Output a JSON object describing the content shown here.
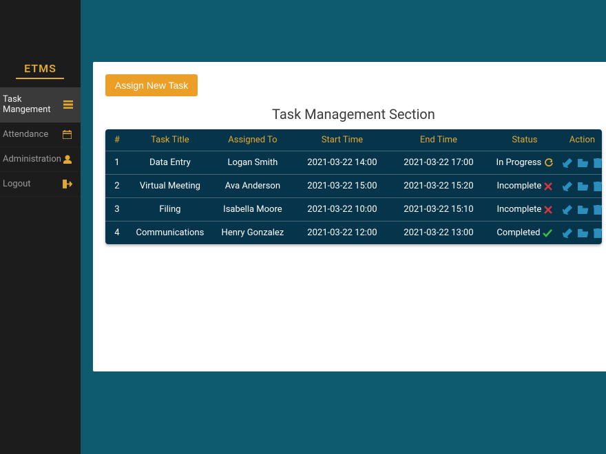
{
  "brand": "ETMS",
  "sidebar": {
    "items": [
      {
        "label": "Task Mangement",
        "icon": "list-icon",
        "active": true
      },
      {
        "label": "Attendance",
        "icon": "calendar-icon",
        "active": false
      },
      {
        "label": "Administration",
        "icon": "user-icon",
        "active": false
      },
      {
        "label": "Logout",
        "icon": "logout-icon",
        "active": false
      }
    ]
  },
  "main": {
    "assign_button": "Assign New Task",
    "section_title": "Task Management Section",
    "columns": {
      "idx": "#",
      "title": "Task Title",
      "assigned": "Assigned To",
      "start": "Start Time",
      "end": "End Time",
      "status": "Status",
      "action": "Action"
    },
    "rows": [
      {
        "idx": "1",
        "title": "Data Entry",
        "assigned": "Logan Smith",
        "start": "2021-03-22 14:00",
        "end": "2021-03-22 17:00",
        "status": "In Progress",
        "status_icon": "refresh"
      },
      {
        "idx": "2",
        "title": "Virtual Meeting",
        "assigned": "Ava Anderson",
        "start": "2021-03-22 15:00",
        "end": "2021-03-22 15:20",
        "status": "Incomplete",
        "status_icon": "cross"
      },
      {
        "idx": "3",
        "title": "Filing",
        "assigned": "Isabella Moore",
        "start": "2021-03-22 10:00",
        "end": "2021-03-22 15:10",
        "status": "Incomplete",
        "status_icon": "cross"
      },
      {
        "idx": "4",
        "title": "Communications",
        "assigned": "Henry Gonzalez",
        "start": "2021-03-22 12:00",
        "end": "2021-03-22 13:00",
        "status": "Completed",
        "status_icon": "check"
      }
    ]
  },
  "colors": {
    "accent": "#e1a933",
    "sidebar_bg": "#1c1c1c",
    "content_bg": "#0e5a6e",
    "table_bg": "#06344a",
    "action_icon": "#2b8fbd",
    "status_refresh": "#e1a933",
    "status_cross": "#d9363e",
    "status_check": "#3fbf3f"
  }
}
